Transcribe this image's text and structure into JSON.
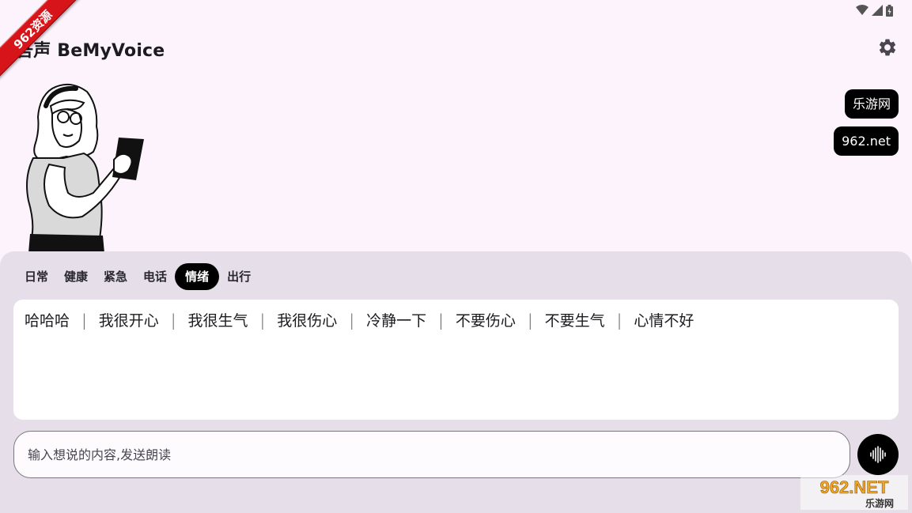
{
  "status_bar": {
    "icons": [
      "wifi-icon",
      "signal-icon",
      "battery-icon"
    ]
  },
  "ribbon": {
    "text": "962资源"
  },
  "app": {
    "title": "吾声 BeMyVoice"
  },
  "header": {
    "settings_icon": "gear-icon"
  },
  "chips": [
    "乐游网",
    "962.net"
  ],
  "tabs": [
    {
      "label": "日常",
      "active": false
    },
    {
      "label": "健康",
      "active": false
    },
    {
      "label": "紧急",
      "active": false
    },
    {
      "label": "电话",
      "active": false
    },
    {
      "label": "情绪",
      "active": true
    },
    {
      "label": "出行",
      "active": false
    }
  ],
  "phrases": [
    "哈哈哈",
    "我很开心",
    "我很生气",
    "我很伤心",
    "冷静一下",
    "不要伤心",
    "不要生气",
    "心情不好"
  ],
  "input": {
    "placeholder": "输入想说的内容,发送朗读",
    "value": ""
  },
  "voice_button": {
    "icon": "voice-wave-icon"
  },
  "watermark": {
    "top": "962.NET",
    "bottom": "乐游网"
  },
  "colors": {
    "background": "#fcf3fd",
    "panel": "#e6dfe9",
    "accent": "#000000",
    "ribbon": "#d7141a"
  }
}
